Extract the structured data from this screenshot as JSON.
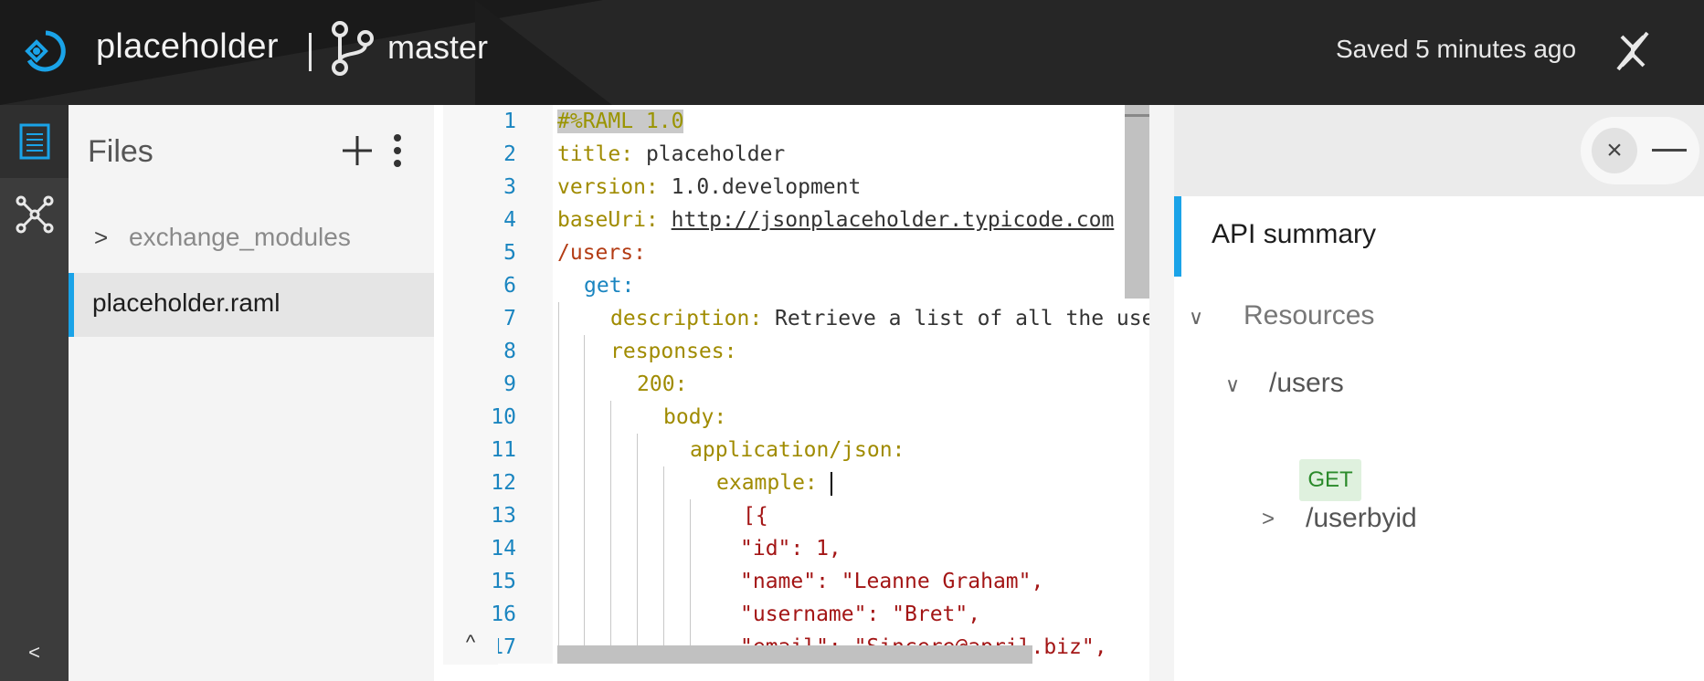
{
  "header": {
    "project_name": "placeholder",
    "branch": "master",
    "save_status": "Saved 5 minutes ago"
  },
  "rail": {
    "collapse_label": "<"
  },
  "files": {
    "title": "Files",
    "folder": {
      "chevron": ">",
      "name": "exchange_modules"
    },
    "active_file": "placeholder.raml"
  },
  "editor": {
    "line_numbers": [
      "1",
      "2",
      "3",
      "4",
      "5",
      "6",
      "7",
      "8",
      "9",
      "10",
      "11",
      "12",
      "13",
      "14",
      "15",
      "16",
      "17"
    ],
    "lines": {
      "l1": "#%RAML 1.0",
      "l2_key": "title:",
      "l2_val": " placeholder",
      "l3_key": "version:",
      "l3_val": " 1.0.development",
      "l4_key": "baseUri:",
      "l4_val": "http://jsonplaceholder.typicode.com",
      "l5": "/users:",
      "l6": "get:",
      "l7_key": "description:",
      "l7_val": " Retrieve a list of all the users",
      "l8": "responses:",
      "l9": "200:",
      "l10": "body:",
      "l11": "application/json:",
      "l12": "example: ",
      "l13": "[{",
      "l14": "\"id\": 1,",
      "l15": "\"name\": \"Leanne Graham\",",
      "l16": "\"username\": \"Bret\",",
      "l17": "\"email\": \"Sincere@april.biz\","
    },
    "expand_label": "^"
  },
  "summary": {
    "tab_label": "API summary",
    "resources_label": "Resources",
    "resource_users": "/users",
    "method_get": "GET",
    "resource_userbyid": "/userbyid",
    "chev_open": "∨",
    "chev_closed": ">"
  },
  "colors": {
    "accent": "#1aa3e8",
    "topbar": "#262626",
    "get_badge": "#dff1de"
  }
}
